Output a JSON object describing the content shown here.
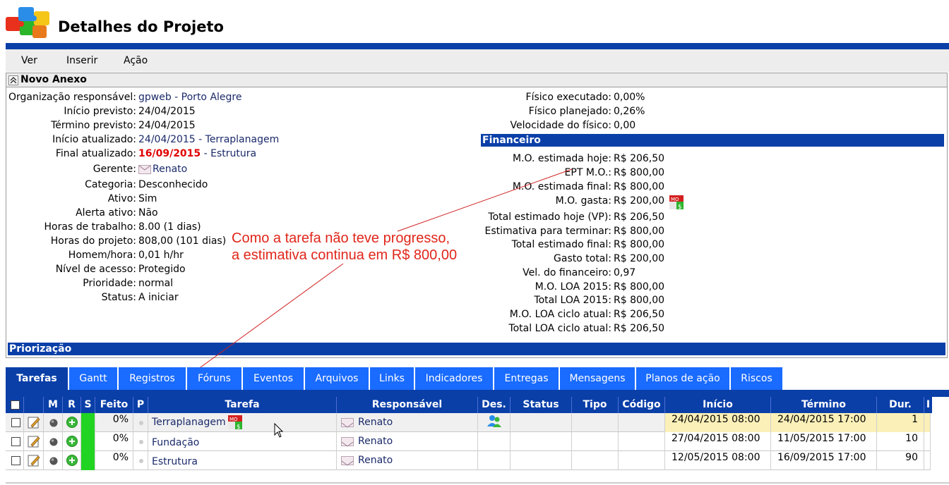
{
  "page": {
    "title": "Detalhes do Projeto"
  },
  "menu": {
    "items": [
      "Ver",
      "Inserir",
      "Ação"
    ]
  },
  "panel": {
    "title": "Novo Anexo",
    "left_fields": [
      {
        "label": "Organização responsável:",
        "value": "gpweb - Porto Alegre"
      },
      {
        "label": "Início previsto:",
        "value": "24/04/2015"
      },
      {
        "label": "Término previsto:",
        "value": "24/04/2015"
      },
      {
        "label": "Início atualizado:",
        "value": "24/04/2015 - Terraplanagem"
      },
      {
        "label": "Final atualizado:",
        "value_red": "16/09/2015",
        "value": " - Estrutura"
      },
      {
        "label": "Gerente:",
        "value": "Renato"
      },
      {
        "label": "Categoria:",
        "value": "Desconhecido"
      },
      {
        "label": "Ativo:",
        "value": "Sim"
      },
      {
        "label": "Alerta ativo:",
        "value": "Não"
      },
      {
        "label": "Horas de trabalho:",
        "value": "8.00 (1 dias)"
      },
      {
        "label": "Horas do projeto:",
        "value": "808,00 (101 dias)"
      },
      {
        "label": "Homem/hora:",
        "value": "0,01 h/hr"
      },
      {
        "label": "Nível de acesso:",
        "value": "Protegido"
      },
      {
        "label": "Prioridade:",
        "value": "normal"
      },
      {
        "label": "Status:",
        "value": "A iniciar"
      }
    ],
    "right_top_fields": [
      {
        "label": "Físico executado:",
        "value": "0,00%"
      },
      {
        "label": "Físico planejado:",
        "value": "0,26%"
      },
      {
        "label": "Velocidade do físico:",
        "value": "0,00"
      }
    ],
    "financeiro_title": "Financeiro",
    "financeiro_fields": [
      {
        "label": "M.O. estimada hoje:",
        "value": "R$ 206,50"
      },
      {
        "label": "EPT M.O.:",
        "value": "R$ 800,00"
      },
      {
        "label": "M.O. estimada final:",
        "value": "R$ 800,00"
      },
      {
        "label": "M.O. gasta:",
        "value": "R$ 200,00"
      },
      {
        "label": "Total estimado hoje (VP):",
        "value": "R$ 206,50"
      },
      {
        "label": "Estimativa para terminar:",
        "value": "R$ 800,00"
      },
      {
        "label": "Total estimado final:",
        "value": "R$ 800,00"
      },
      {
        "label": "Gasto total:",
        "value": "R$ 200,00"
      },
      {
        "label": "Vel. do financeiro:",
        "value": "0,97"
      },
      {
        "label": "M.O. LOA 2015:",
        "value": "R$ 800,00"
      },
      {
        "label": "Total LOA 2015:",
        "value": "R$ 800,00"
      },
      {
        "label": "M.O. LOA ciclo atual:",
        "value": "R$ 206,50"
      },
      {
        "label": "Total LOA ciclo atual:",
        "value": "R$ 206,50"
      }
    ],
    "priorizacao_title": "Priorização"
  },
  "annotation": {
    "line1": "Como a tarefa não teve progresso,",
    "line2": "a estimativa continua em R$ 800,00",
    "color": "#e0261a"
  },
  "tabs": [
    "Tarefas",
    "Gantt",
    "Registros",
    "Fóruns",
    "Eventos",
    "Arquivos",
    "Links",
    "Indicadores",
    "Entregas",
    "Mensagens",
    "Planos de ação",
    "Riscos"
  ],
  "table": {
    "headers": {
      "m": "M",
      "r": "R",
      "s": "S",
      "feito": "Feito",
      "p": "P",
      "tarefa": "Tarefa",
      "responsavel": "Responsável",
      "des": "Des.",
      "status": "Status",
      "tipo": "Tipo",
      "codigo": "Código",
      "inicio": "Início",
      "termino": "Término",
      "dur": "Dur.",
      "extra": "I"
    },
    "rows": [
      {
        "feito": "0%",
        "tarefa": "Terraplanagem",
        "responsavel": "Renato",
        "inicio": "24/04/2015 08:00",
        "termino": "24/04/2015 17:00",
        "dur": "1"
      },
      {
        "feito": "0%",
        "tarefa": "Fundação",
        "responsavel": "Renato",
        "inicio": "27/04/2015 08:00",
        "termino": "11/05/2015 17:00",
        "dur": "10"
      },
      {
        "feito": "0%",
        "tarefa": "Estrutura",
        "responsavel": "Renato",
        "inicio": "12/05/2015 08:00",
        "termino": "16/09/2015 17:00",
        "dur": "90"
      }
    ]
  },
  "colors": {
    "brand_blue": "#0a3fa8",
    "tab_blue": "#1a6bff",
    "status_green": "#22d422",
    "highlight_yellow": "#fbf0b8"
  }
}
